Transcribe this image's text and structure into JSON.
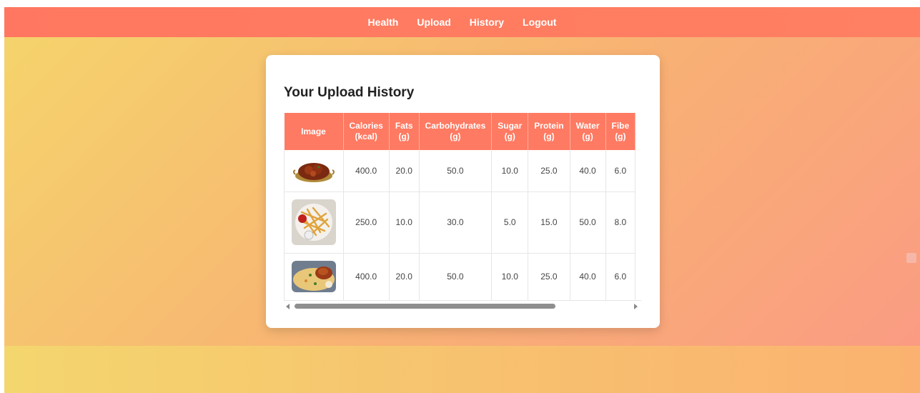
{
  "nav": {
    "links": [
      "Health",
      "Upload",
      "History",
      "Logout"
    ]
  },
  "page": {
    "title": "Your Upload History"
  },
  "table": {
    "headers": [
      [
        "Image"
      ],
      [
        "Calories",
        "(kcal)"
      ],
      [
        "Fats",
        "(g)"
      ],
      [
        "Carbohydrates",
        "(g)"
      ],
      [
        "Sugar",
        "(g)"
      ],
      [
        "Protein",
        "(g)"
      ],
      [
        "Water",
        "(g)"
      ],
      [
        "Fibe",
        "(g)"
      ]
    ],
    "rows": [
      {
        "image": "curry-dish-image",
        "values": [
          "400.0",
          "20.0",
          "50.0",
          "10.0",
          "25.0",
          "40.0",
          "6.0"
        ]
      },
      {
        "image": "fries-dish-image",
        "values": [
          "250.0",
          "10.0",
          "30.0",
          "5.0",
          "15.0",
          "50.0",
          "8.0"
        ]
      },
      {
        "image": "rice-chicken-dish-image",
        "values": [
          "400.0",
          "20.0",
          "50.0",
          "10.0",
          "25.0",
          "40.0",
          "6.0"
        ]
      }
    ]
  },
  "colors": {
    "nav_bg": "#ff7760",
    "header_bg": "#ff7a62",
    "bg_gradient_start": "#f5d56b",
    "bg_gradient_end": "#fb9a84"
  },
  "icons": {
    "side_icon": "mail-icon"
  }
}
